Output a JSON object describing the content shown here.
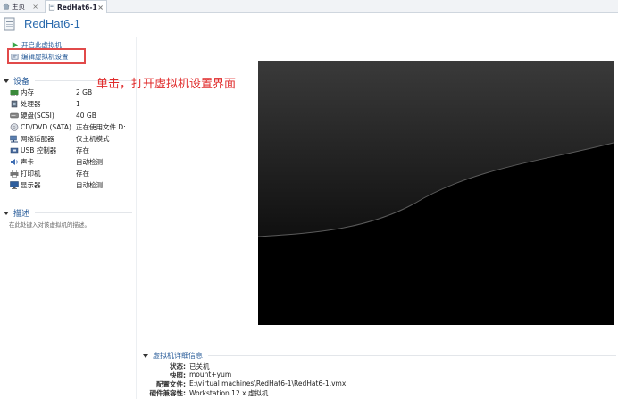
{
  "tabs": [
    {
      "label": "主页",
      "icon": "home-icon",
      "close": "×"
    },
    {
      "label": "RedHat6-1",
      "icon": "vm-tab-icon",
      "close": "×"
    }
  ],
  "vm": {
    "title": "RedHat6-1"
  },
  "actions": {
    "power_on": "开启此虚拟机",
    "edit_settings": "编辑虚拟机设置"
  },
  "devices_section": {
    "title": "设备"
  },
  "devices": [
    {
      "name": "内存",
      "value": "2 GB",
      "icon": "memory-icon"
    },
    {
      "name": "处理器",
      "value": "1",
      "icon": "cpu-icon"
    },
    {
      "name": "硬盘(SCSI)",
      "value": "40 GB",
      "icon": "harddisk-icon"
    },
    {
      "name": "CD/DVD (SATA)",
      "value": "正在使用文件 D:...",
      "icon": "cdrom-icon"
    },
    {
      "name": "网络适配器",
      "value": "仅主机模式",
      "icon": "network-icon"
    },
    {
      "name": "USB 控制器",
      "value": "存在",
      "icon": "usb-icon"
    },
    {
      "name": "声卡",
      "value": "自动检测",
      "icon": "sound-icon"
    },
    {
      "name": "打印机",
      "value": "存在",
      "icon": "printer-icon"
    },
    {
      "name": "显示器",
      "value": "自动检测",
      "icon": "display-icon"
    }
  ],
  "description_section": {
    "title": "描述",
    "placeholder": "在此处键入对该虚拟机的描述。"
  },
  "annotation": "单击，打开虚拟机设置界面",
  "details": {
    "title": "虚拟机详细信息",
    "rows": [
      {
        "key": "状态:",
        "value": "已关机"
      },
      {
        "key": "快照:",
        "value": "mount+yum"
      },
      {
        "key": "配置文件:",
        "value": "E:\\virtual machines\\RedHat6-1\\RedHat6-1.vmx"
      },
      {
        "key": "硬件兼容性:",
        "value": "Workstation 12.x 虚拟机"
      }
    ]
  },
  "colors": {
    "accent": "#2a6aad",
    "annotation": "#e02b2b"
  }
}
